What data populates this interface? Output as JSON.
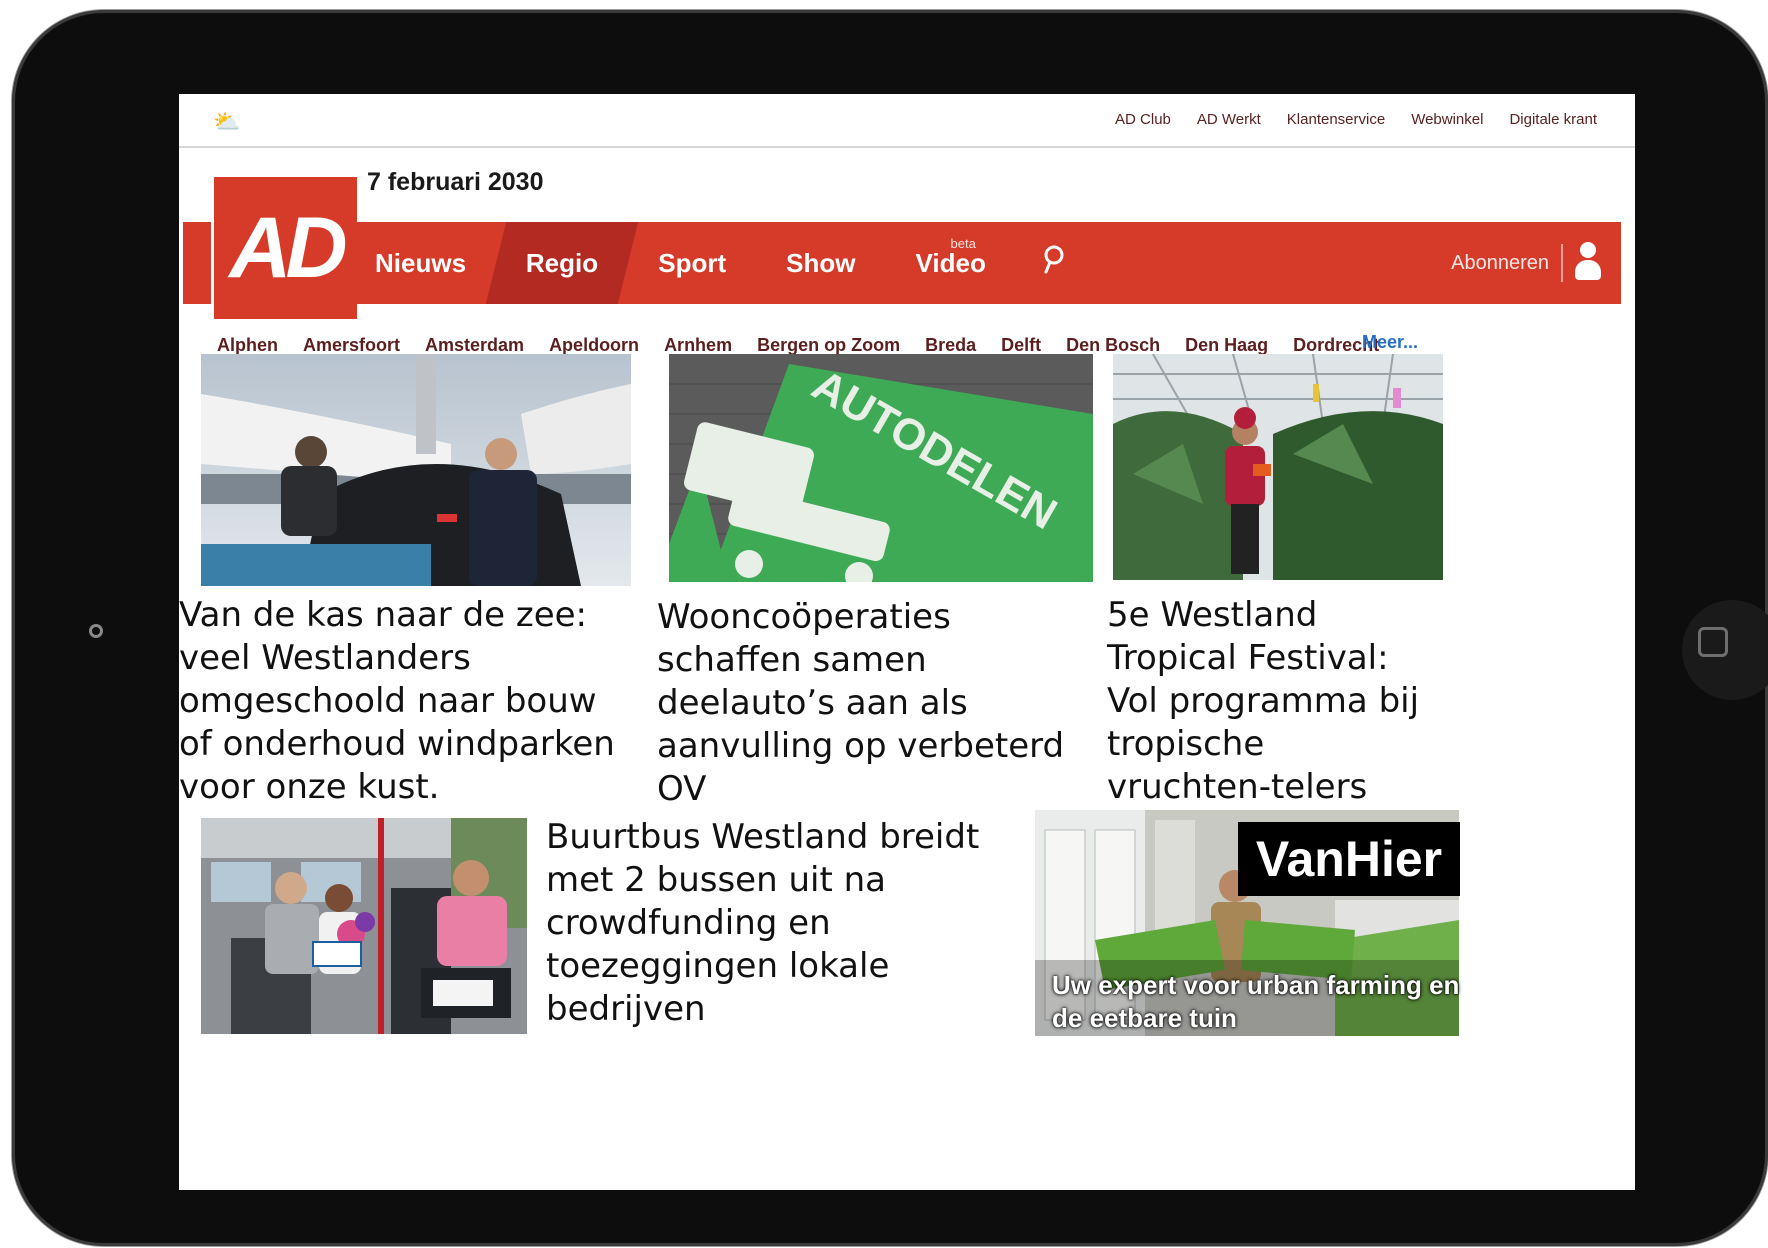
{
  "topbar": {
    "weather_icon": "cloud-sun-icon",
    "links": [
      "AD Club",
      "AD Werkt",
      "Klantenservice",
      "Webwinkel",
      "Digitale krant"
    ]
  },
  "date": "7 februari 2030",
  "logo": "AD",
  "nav": {
    "items": [
      "Nieuws",
      "Regio",
      "Sport",
      "Show",
      "Video"
    ],
    "active": "Regio",
    "video_badge": "beta",
    "search_icon": "search-icon",
    "subscribe": "Abonneren",
    "user_icon": "user-icon",
    "accent_color": "#d63b2a"
  },
  "regions": {
    "items": [
      "Alphen",
      "Amersfoort",
      "Amsterdam",
      "Apeldoorn",
      "Arnhem",
      "Bergen op Zoom",
      "Breda",
      "Delft",
      "Den Bosch",
      "Den Haag",
      "Dordrecht"
    ],
    "more": "Meer..."
  },
  "articles": [
    {
      "headline": "Van de kas naar de zee: veel Westlanders omgeschoold naar bouw of onderhoud windparken voor onze kust."
    },
    {
      "headline": "Wooncoöperaties schaffen samen deelauto’s aan als aanvulling op verbeterd OV"
    },
    {
      "headline": "5e Westland Tropical Festival: Vol programma bij tropische vruchten-telers"
    },
    {
      "headline": "Buurtbus Westland breidt met 2 bussen uit na crowdfunding en toezeggingen lokale bedrijven"
    }
  ],
  "ad": {
    "brand": "VanHier",
    "tagline": "Uw expert voor urban farming en de eetbare tuin"
  },
  "photo_texts": {
    "parking": "AUTODELEN"
  }
}
